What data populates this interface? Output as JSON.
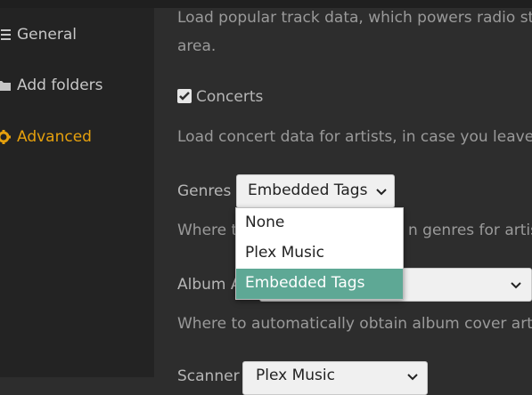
{
  "sidebar": {
    "items": [
      {
        "label": "General",
        "icon": "list-icon",
        "active": false
      },
      {
        "label": "Add folders",
        "icon": "folder-icon",
        "active": false
      },
      {
        "label": "Advanced",
        "icon": "gear-icon",
        "active": true
      }
    ]
  },
  "content": {
    "popular_desc_line1": "Load popular track data, which powers radio st",
    "popular_desc_line2": "area.",
    "concerts_label": "Concerts",
    "concerts_checked": true,
    "concerts_desc": "Load concert data for artists, in case you leave",
    "genres_label": "Genres",
    "genres_value": "Embedded Tags",
    "genres_desc_left": "Where t",
    "genres_desc_right": "n genres for artist",
    "album_label": "Album A",
    "album_desc": "Where to automatically obtain album cover art.",
    "scanner_label": "Scanner",
    "scanner_value": "Plex Music"
  },
  "dropdown": {
    "options": [
      "None",
      "Plex Music",
      "Embedded Tags"
    ],
    "selected_index": 2
  },
  "colors": {
    "accent": "#e5a00d",
    "selected_option": "#5ea895",
    "background": "#2d2d2d",
    "sidebar": "#232323"
  }
}
